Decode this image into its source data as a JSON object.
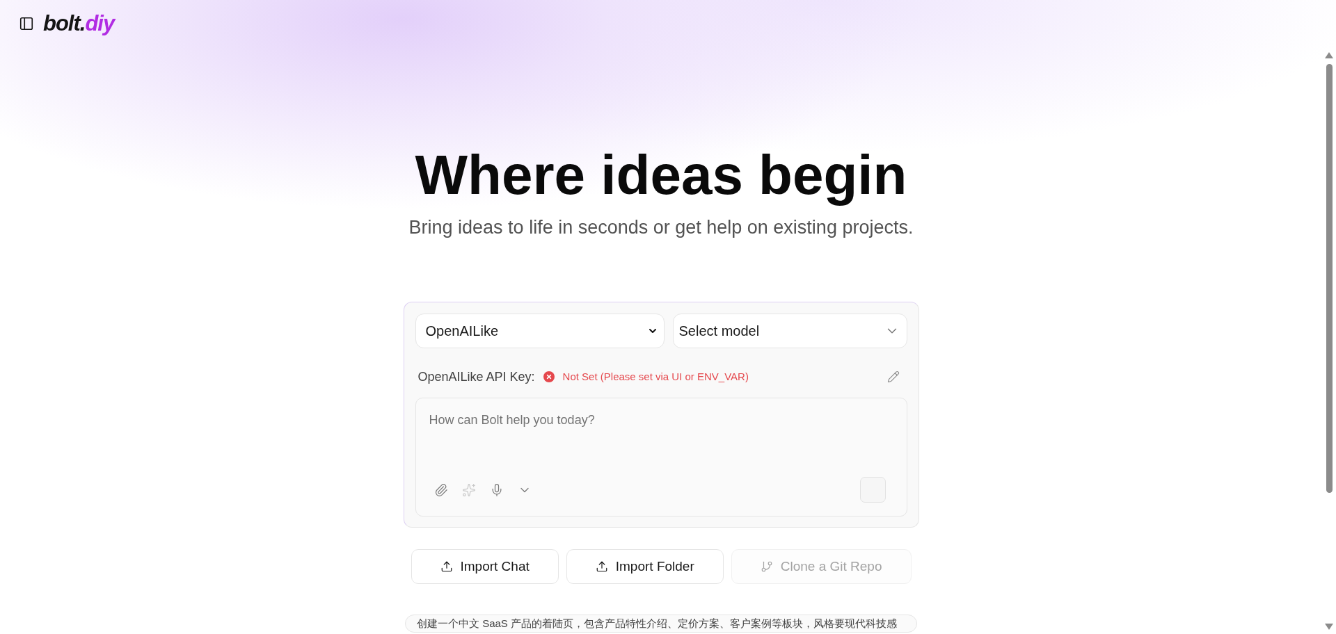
{
  "header": {
    "logo": {
      "text": "bolt.",
      "accent": "diy"
    }
  },
  "hero": {
    "title": "Where ideas begin",
    "subtitle": "Bring ideas to life in seconds or get help on existing projects."
  },
  "chat_box": {
    "provider_select": {
      "value": "OpenAILike"
    },
    "model_select": {
      "value": "Select model"
    },
    "api_key": {
      "label": "OpenAILike API Key:",
      "set": false,
      "status": "Not Set (Please set via UI or ENV_VAR)"
    },
    "prompt": {
      "placeholder": "How can Bolt help you today?"
    },
    "toolbar": [
      {
        "kind": "attach",
        "disabled": false
      },
      {
        "kind": "enhance",
        "disabled": true
      },
      {
        "kind": "voice",
        "disabled": false
      },
      {
        "kind": "more",
        "disabled": false
      }
    ]
  },
  "actions": [
    {
      "label": "Import Chat",
      "kind": "upload",
      "disabled": false
    },
    {
      "label": "Import Folder",
      "kind": "upload",
      "disabled": false
    },
    {
      "label": "Clone a Git Repo",
      "kind": "git",
      "disabled": true
    }
  ],
  "examples": [
    {
      "label": "创建一个中文 SaaS 产品的着陆页，包含产品特性介绍、定价方案、客户案例等板块，风格要现代科技感"
    }
  ]
}
